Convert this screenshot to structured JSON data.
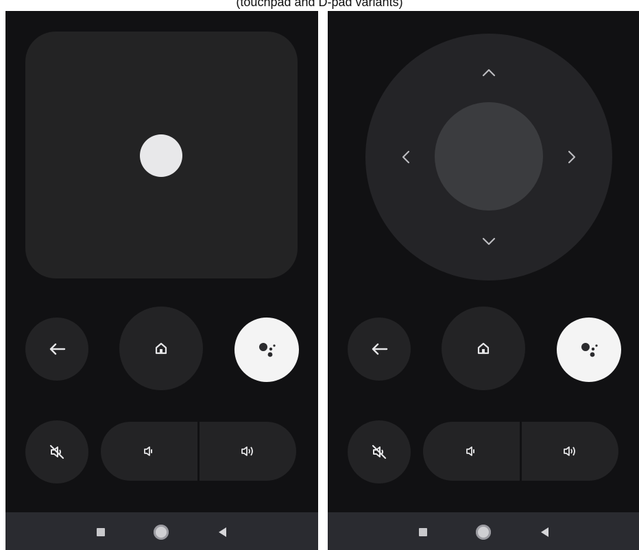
{
  "caption": "(touchpad and D-pad variants)",
  "colors": {
    "screen_bg": "#111113",
    "button_bg": "#232325",
    "assistant_bg": "#f4f4f4",
    "dpad_ring": "#242427",
    "dpad_center": "#3b3c3f",
    "navbar_bg": "#2a2b30"
  },
  "left_panel": {
    "mode": "touchpad",
    "icons": [
      "back-arrow-icon",
      "home-icon",
      "google-assistant-icon",
      "volume-mute-icon",
      "volume-down-icon",
      "volume-up-icon"
    ]
  },
  "right_panel": {
    "mode": "dpad",
    "icons": [
      "chevron-up-icon",
      "chevron-down-icon",
      "chevron-left-icon",
      "chevron-right-icon",
      "back-arrow-icon",
      "home-icon",
      "google-assistant-icon",
      "volume-mute-icon",
      "volume-down-icon",
      "volume-up-icon"
    ]
  },
  "navbar": {
    "icons": [
      "recent-apps-icon",
      "home-circle-icon",
      "back-triangle-icon"
    ]
  }
}
